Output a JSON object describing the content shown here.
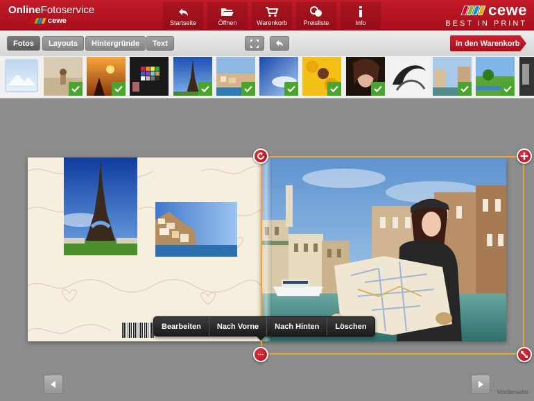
{
  "header": {
    "brand_bold": "Online",
    "brand_light": "Fotoservice",
    "brand_sub": "cewe",
    "nav": [
      {
        "label": "Startseite",
        "icon": "undo-arrow-icon"
      },
      {
        "label": "Öffnen",
        "icon": "folder-open-icon"
      },
      {
        "label": "Warenkorb",
        "icon": "shopping-cart-icon"
      },
      {
        "label": "Preisliste",
        "icon": "coins-icon"
      },
      {
        "label": "Info",
        "icon": "info-icon"
      }
    ],
    "logo_text": "cewe",
    "logo_tagline": "BEST IN PRINT",
    "colors": {
      "red": "#b81522",
      "stripe1": "#e2001a",
      "stripe2": "#7ab929",
      "stripe3": "#0095db",
      "stripe4": "#f7a600"
    }
  },
  "toolbar": {
    "tabs": [
      "Fotos",
      "Layouts",
      "Hintergründe",
      "Text"
    ],
    "active_tab": "Fotos",
    "cart_label": "In den Warenkorb"
  },
  "thumbnails": [
    {
      "name": "beach-child",
      "checked": true
    },
    {
      "name": "sunset-couple",
      "checked": true
    },
    {
      "name": "color-chart",
      "checked": false
    },
    {
      "name": "eiffel-tower",
      "checked": true
    },
    {
      "name": "amalfi-coast",
      "checked": true
    },
    {
      "name": "sky-clouds",
      "checked": true
    },
    {
      "name": "sunflowers-woman",
      "checked": true
    },
    {
      "name": "woman-portrait",
      "checked": true
    },
    {
      "name": "abstract-swirl",
      "checked": false
    },
    {
      "name": "venice-canal",
      "checked": true
    },
    {
      "name": "green-landscape",
      "checked": true
    }
  ],
  "context_menu": [
    "Bearbeiten",
    "Nach Vorne",
    "Nach Hinten",
    "Löschen"
  ],
  "more_button": "...",
  "page_label": "Vorderseite",
  "accent": "#e8a92a"
}
